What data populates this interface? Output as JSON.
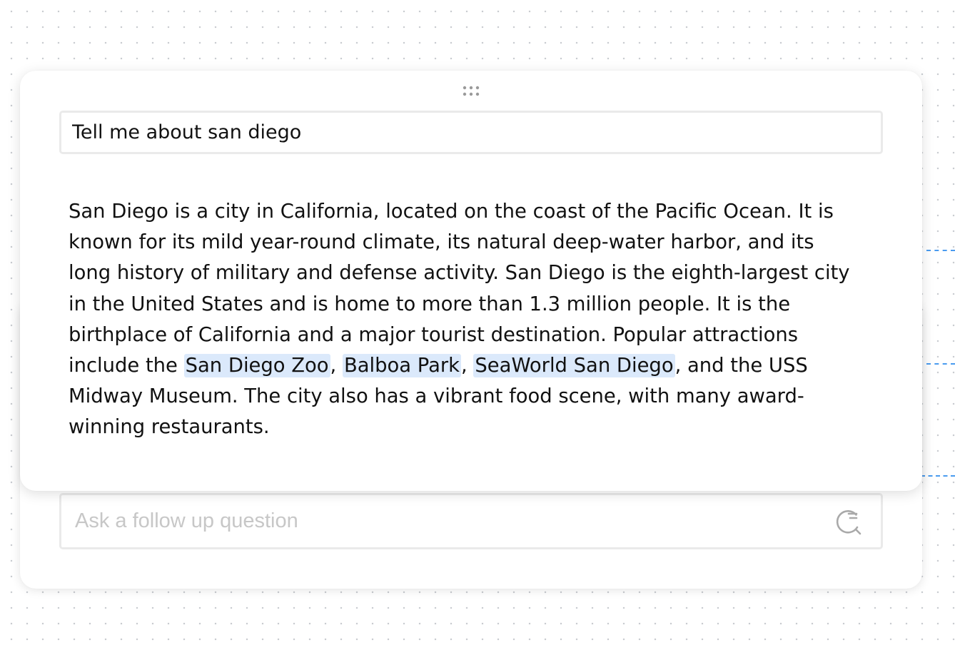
{
  "question": {
    "value": "Tell me about san diego"
  },
  "answer": {
    "line1": "San Diego is a city in California, located on the coast of the Pacific Ocean. It is",
    "line2": "known for its mild year-round climate, its natural deep-water harbor, and its",
    "line3": "long history of military and defense activity. San Diego is the eighth-largest city",
    "line4": "in the United States and is home to more than 1.3 million people. It is the",
    "line5": "birthplace of California and a major tourist destination. Popular attractions",
    "line6_prefix": "include the ",
    "highlights": [
      "San Diego Zoo",
      "Balboa Park",
      "SeaWorld San Diego"
    ],
    "separator": ", ",
    "line6_suffix": ", and the USS",
    "line7": "Midway Museum. The city also has a vibrant food scene, with many award-",
    "line8": "winning restaurants."
  },
  "followup": {
    "placeholder": "Ask a follow up question",
    "value": "",
    "icon": "ask-search-icon"
  },
  "colors": {
    "highlight": "#dbe9fb",
    "connector": "#4a9bef",
    "border": "#eaeaea"
  }
}
